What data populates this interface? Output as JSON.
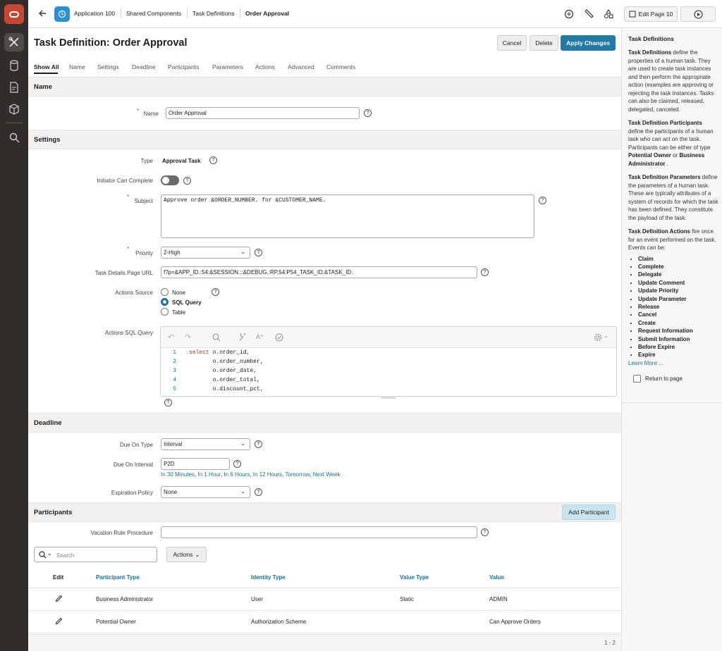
{
  "topbar": {
    "breadcrumbs": [
      "Application 100",
      "Shared Components",
      "Task Definitions",
      "Order Approval"
    ],
    "edit_page_label": "Edit Page 10"
  },
  "page": {
    "title": "Task Definition: Order Approval",
    "cancel_label": "Cancel",
    "delete_label": "Delete",
    "apply_label": "Apply Changes",
    "tabs": [
      "Show All",
      "Name",
      "Settings",
      "Deadline",
      "Participants",
      "Parameters",
      "Actions",
      "Advanced",
      "Comments"
    ]
  },
  "name_section": {
    "heading": "Name",
    "name_label": "Name",
    "name_value": "Order Approval"
  },
  "settings": {
    "heading": "Settings",
    "type_label": "Type",
    "type_value": "Approval Task",
    "initiator_label": "Initiator Can Complete",
    "subject_label": "Subject",
    "subject_value": "Approve order &ORDER_NUMBER. for &CUSTOMER_NAME.",
    "priority_label": "Priority",
    "priority_value": "2-High",
    "details_url_label": "Task Details Page URL",
    "details_url_value": "f?p=&APP_ID.:54:&SESSION.::&DEBUG.:RP,54:P54_TASK_ID:&TASK_ID.",
    "actions_source_label": "Actions Source",
    "actions_source_options": [
      "None",
      "SQL Query",
      "Table"
    ],
    "actions_query_label": "Actions SQL Query",
    "code_lines": [
      {
        "num": "1",
        "kw": "select",
        "text": " o.order_id,"
      },
      {
        "num": "2",
        "kw": "",
        "text": "       o.order_number,"
      },
      {
        "num": "3",
        "kw": "",
        "text": "       o.order_date,"
      },
      {
        "num": "4",
        "kw": "",
        "text": "       o.order_total,"
      },
      {
        "num": "5",
        "kw": "",
        "text": "       o.discount_pct,"
      }
    ]
  },
  "deadline": {
    "heading": "Deadline",
    "due_type_label": "Due On Type",
    "due_type_value": "Interval",
    "due_interval_label": "Due On Interval",
    "due_interval_value": "P2D",
    "quick_picks": [
      "In 30 Minutes",
      "In 1 Hour",
      "In 6 Hours",
      "In 12 Hours",
      "Tomorrow",
      "Next Week"
    ],
    "expiration_label": "Expiration Policy",
    "expiration_value": "None"
  },
  "participants": {
    "heading": "Participants",
    "add_label": "Add Participant",
    "vacation_label": "Vacation Rule Procedure",
    "search_placeholder": "Search",
    "actions_menu_label": "Actions",
    "columns": [
      "Edit",
      "Participant Type",
      "Identity Type",
      "Value Type",
      "Value"
    ],
    "rows": [
      {
        "participant_type": "Business Administrator",
        "identity_type": "User",
        "value_type": "Static",
        "value": "ADMIN"
      },
      {
        "participant_type": "Potential Owner",
        "identity_type": "Authorization Scheme",
        "value_type": "",
        "value": "Can Approve Orders"
      }
    ],
    "pagination": "1 - 2"
  },
  "help_panel": {
    "title": "Task Definitions",
    "p1_bold": "Task Definitions",
    "p1": " define the properties of a human task. They are used to create task instances and then perform the appropriate action (examples are approving or rejecting the task instances. Tasks can also be claimed, released, delegated, canceled.",
    "p2_bold": "Task Definition Participants",
    "p2": " define the participants of a human task who can act on the task. Participants can be either of type ",
    "p2_b2": "Potential Owner",
    "p2_mid": " or ",
    "p2_b3": "Business Administrator",
    "p2_end": " .",
    "p3_bold": "Task Definition Parameters",
    "p3": " define the parameters of a human task. These are typically attributes of a system of records for which the task has been defined. They constitute the payload of the task.",
    "p4_bold": "Task Definition Actions",
    "p4": " fire once for an event performed on the task. Events can be:",
    "events": [
      "Claim",
      "Complete",
      "Delegate",
      "Update Comment",
      "Update Priority",
      "Update Parameter",
      "Release",
      "Cancel",
      "Create",
      "Request Information",
      "Submit Information",
      "Before Expire",
      "Expire"
    ],
    "learn_more": "Learn More ...",
    "return_label": "Return to page"
  }
}
